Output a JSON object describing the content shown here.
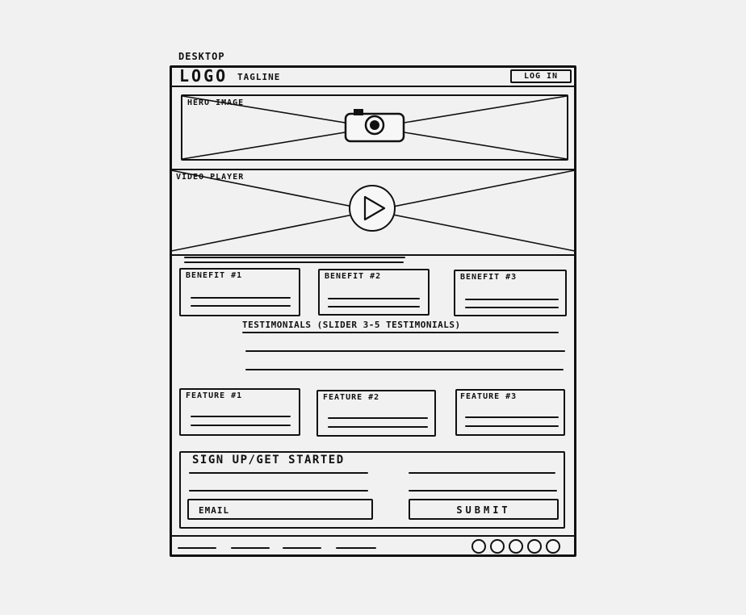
{
  "device_label": "DESKTOP",
  "header": {
    "logo": "LOGO",
    "tagline": "TAGLINE",
    "login_button": "LOG IN"
  },
  "hero": {
    "label": "HERO IMAGE",
    "icon": "camera-icon"
  },
  "video": {
    "label": "VIDEO PLAYER",
    "icon": "play-icon"
  },
  "benefits": [
    {
      "label": "BENEFIT #1"
    },
    {
      "label": "BENEFIT #2"
    },
    {
      "label": "BENEFIT #3"
    }
  ],
  "testimonials": {
    "label": "TESTIMONIALS (SLIDER 3-5 TESTIMONIALS)"
  },
  "features": [
    {
      "label": "FEATURE #1"
    },
    {
      "label": "FEATURE #2"
    },
    {
      "label": "FEATURE #3"
    }
  ],
  "signup": {
    "title": "SIGN UP/GET STARTED",
    "email_placeholder": "EMAIL",
    "submit_label": "SUBMIT"
  },
  "footer": {
    "social_icon_count": 5
  },
  "colors": {
    "ink": "#111111",
    "paper": "#f1f1f1"
  }
}
